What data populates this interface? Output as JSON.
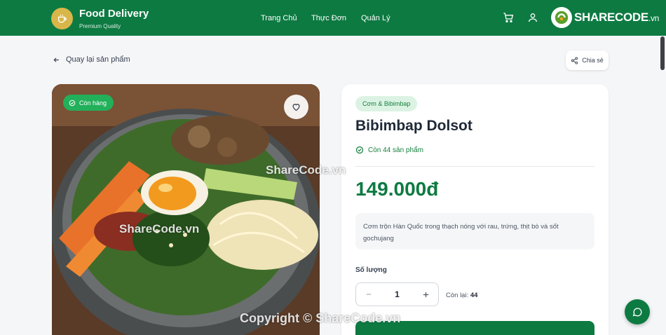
{
  "header": {
    "brand_title": "Food Delivery",
    "brand_subtitle": "Premium Quality",
    "nav": [
      "Trang Chủ",
      "Thực Đơn",
      "Quản Lý"
    ],
    "watermark": {
      "main": "SHARECODE",
      "domain": ".vn"
    },
    "colors": {
      "background": "#0d7a42",
      "logo": "#d9b64a"
    }
  },
  "back_label": "Quay lại sản phẩm",
  "share_label": "Chia sẻ",
  "image": {
    "stock_badge": "Còn hàng"
  },
  "product": {
    "category": "Cơm & Bibimbap",
    "name": "Bibimbap Dolsot",
    "stock_text": "Còn 44 sản phẩm",
    "price": "149.000đ",
    "description": "Cơm trộn Hàn Quốc trong thạch nóng với rau, trứng, thịt bò và sốt gochujang",
    "quantity_label": "Số lượng",
    "quantity": "1",
    "remaining_label": "Còn lại:",
    "remaining_value": "44"
  },
  "watermarks": {
    "center": "ShareCode.vn",
    "left": "ShareCode.vn",
    "footer": "Copyright © ShareCode.vn"
  },
  "colors": {
    "accent": "#0d7a42",
    "badge": "#22b05a"
  }
}
